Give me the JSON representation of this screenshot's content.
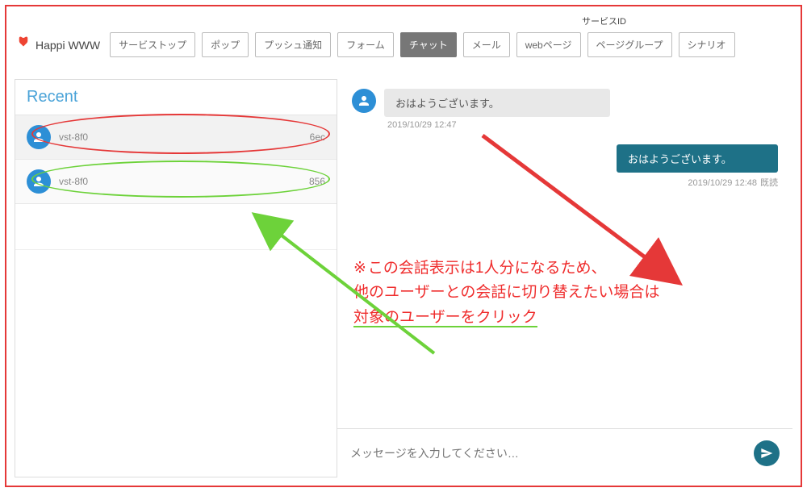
{
  "header": {
    "service_id_label": "サービスID",
    "logo_text": "Happi WWW",
    "nav": [
      {
        "label": "サービストップ",
        "active": false
      },
      {
        "label": "ポップ",
        "active": false
      },
      {
        "label": "プッシュ通知",
        "active": false
      },
      {
        "label": "フォーム",
        "active": false
      },
      {
        "label": "チャット",
        "active": true
      },
      {
        "label": "メール",
        "active": false
      },
      {
        "label": "webページ",
        "active": false
      },
      {
        "label": "ページグループ",
        "active": false
      },
      {
        "label": "シナリオ",
        "active": false
      }
    ]
  },
  "sidebar": {
    "title": "Recent",
    "items": [
      {
        "prefix": "vst-8f0",
        "suffix": "6ec"
      },
      {
        "prefix": "vst-8f0",
        "suffix": "856"
      }
    ]
  },
  "chat": {
    "messages": [
      {
        "side": "left",
        "text": "おはようございます。",
        "time": "2019/10/29 12:47"
      },
      {
        "side": "right",
        "text": "おはようございます。",
        "time": "2019/10/29 12:48",
        "read_label": "既読"
      }
    ],
    "input_placeholder": "メッセージを入力してください…"
  },
  "annotation": {
    "mark": "※",
    "line1": "この会話表示は1人分になるため、",
    "line2": "他のユーザーとの会話に切り替えたい場合は",
    "line3": "対象のユーザーをクリック"
  }
}
